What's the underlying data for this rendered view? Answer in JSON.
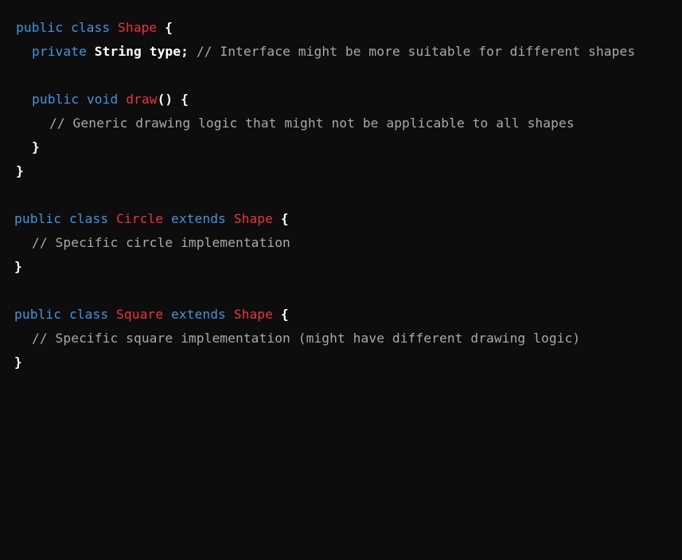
{
  "code": {
    "line1": {
      "kw1": "public",
      "kw2": "class",
      "cls": "Shape",
      "brace": "{"
    },
    "line2": {
      "kw": "private",
      "type": "String",
      "field": "type;",
      "comment": "// Interface might be more suitable for different shapes"
    },
    "line3": {
      "kw1": "public",
      "kw2": "void",
      "fn": "draw",
      "punc": "() {"
    },
    "line4": {
      "comment": "// Generic drawing logic that might not be applicable to all shapes"
    },
    "line5": {
      "brace": "}"
    },
    "line6": {
      "brace": "}"
    },
    "line7": {
      "kw1": "public",
      "kw2": "class",
      "cls": "Circle",
      "kw3": "extends",
      "parent": "Shape",
      "brace": "{"
    },
    "line8": {
      "comment": "// Specific circle implementation"
    },
    "line9": {
      "brace": "}"
    },
    "line10": {
      "kw1": "public",
      "kw2": "class",
      "cls": "Square",
      "kw3": "extends",
      "parent": "Shape",
      "brace": "{"
    },
    "line11": {
      "comment": "// Specific square implementation (might have different drawing logic)"
    },
    "line12": {
      "brace": "}"
    }
  },
  "colors": {
    "background": "#0d0d0d",
    "keyword": "#3f96e0",
    "class_name": "#f0323c",
    "plain": "#ffffff",
    "comment": "#a9a9a9"
  }
}
